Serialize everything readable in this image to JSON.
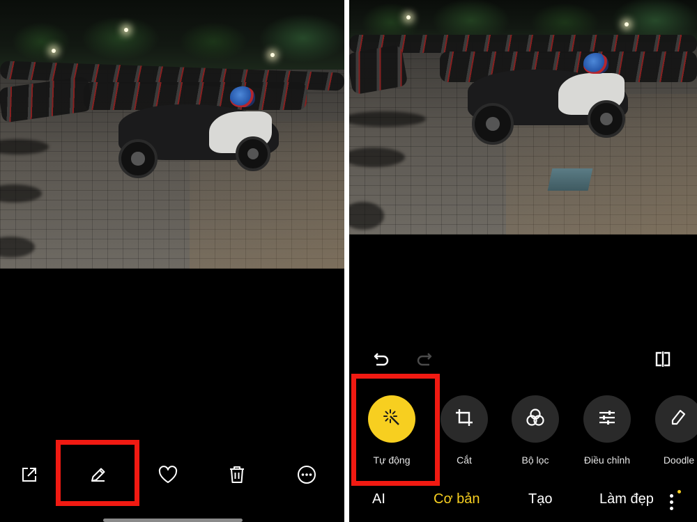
{
  "left_screen": {
    "photo": {
      "description_icon": "night-parking-lot-photo"
    },
    "actions": [
      {
        "name": "share",
        "icon": "share-icon"
      },
      {
        "name": "edit",
        "icon": "edit-pencil-icon"
      },
      {
        "name": "favorite",
        "icon": "heart-icon"
      },
      {
        "name": "delete",
        "icon": "trash-icon"
      },
      {
        "name": "more",
        "icon": "more-icon"
      }
    ],
    "highlighted_action": "edit"
  },
  "right_screen": {
    "history": {
      "undo_icon": "undo-icon",
      "redo_icon": "redo-icon",
      "compare_icon": "compare-icon"
    },
    "tools": [
      {
        "label": "Tự động",
        "icon": "magic-wand-icon",
        "active": true
      },
      {
        "label": "Cắt",
        "icon": "crop-icon",
        "active": false
      },
      {
        "label": "Bộ lọc",
        "icon": "filter-icon",
        "active": false
      },
      {
        "label": "Điều chỉnh",
        "icon": "sliders-icon",
        "active": false
      },
      {
        "label": "Doodle",
        "icon": "doodle-icon",
        "active": false
      }
    ],
    "tabs": [
      {
        "label": "AI",
        "active": false
      },
      {
        "label": "Cơ bản",
        "active": true
      },
      {
        "label": "Tạo",
        "active": false
      },
      {
        "label": "Làm đẹp",
        "active": false
      }
    ],
    "highlighted_tool": "Tự động"
  },
  "colors": {
    "accent": "#f7cf20",
    "highlight_border": "#f11a12",
    "background": "#000000",
    "tool_circle": "#2a2a2a"
  }
}
